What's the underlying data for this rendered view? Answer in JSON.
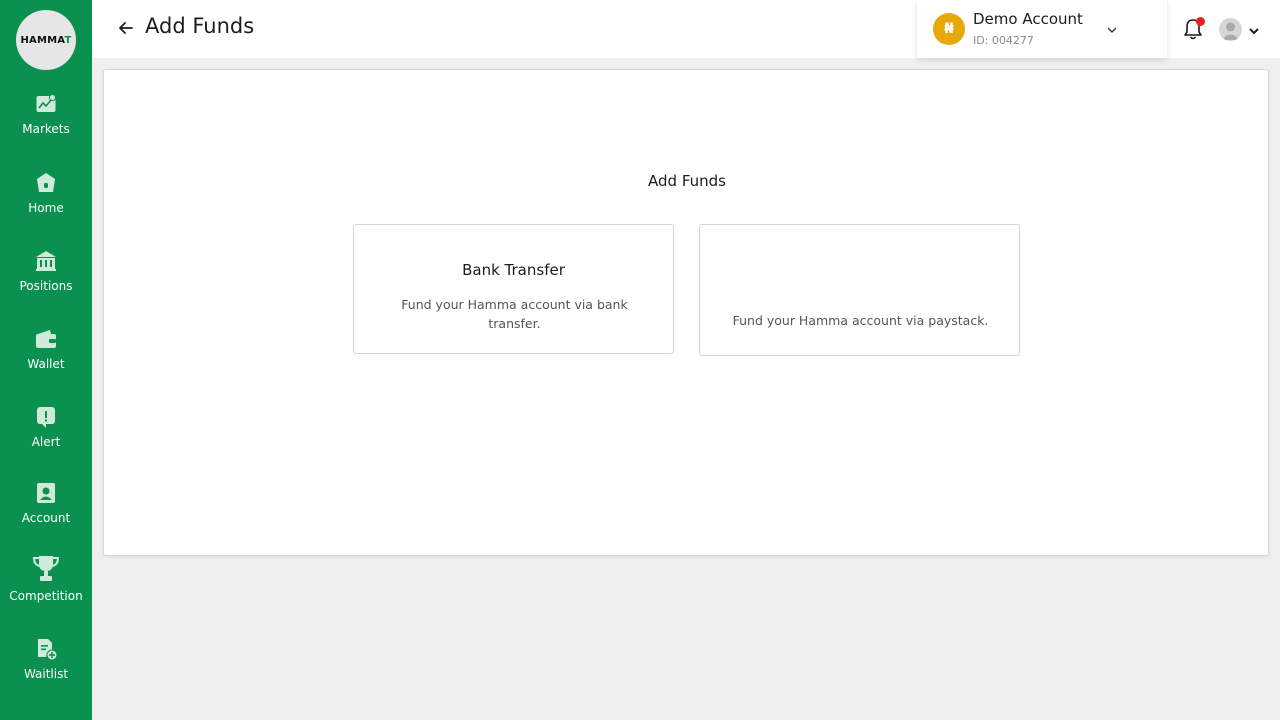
{
  "app": {
    "logo_text": "HAMMA",
    "logo_accent": "T",
    "brand_color": "#0a9150"
  },
  "sidebar": {
    "items": [
      {
        "label": "Markets",
        "icon": "chart-line-icon"
      },
      {
        "label": "Home",
        "icon": "home-icon"
      },
      {
        "label": "Positions",
        "icon": "bank-icon"
      },
      {
        "label": "Wallet",
        "icon": "wallet-icon"
      },
      {
        "label": "Alert",
        "icon": "alert-icon"
      },
      {
        "label": "Account",
        "icon": "account-icon"
      },
      {
        "label": "Competition",
        "icon": "trophy-icon"
      },
      {
        "label": "Waitlist",
        "icon": "waitlist-icon"
      }
    ]
  },
  "header": {
    "title": "Add Funds",
    "account": {
      "currency_symbol": "₦",
      "name": "Demo Account",
      "id_text": "ID: 004277"
    },
    "notification_dot_color": "#e8201e"
  },
  "main": {
    "section_title": "Add Funds",
    "options": [
      {
        "title": "Bank Transfer",
        "description": "Fund your Hamma account via bank transfer."
      },
      {
        "title": "",
        "description": "Fund your Hamma account via paystack."
      }
    ]
  }
}
